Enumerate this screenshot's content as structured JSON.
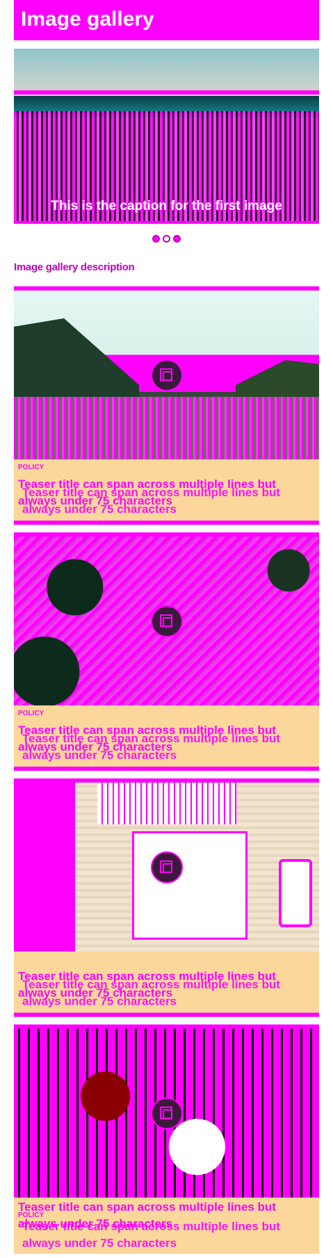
{
  "header": {
    "title": "Image gallery"
  },
  "hero": {
    "caption": "This is the caption for the first image"
  },
  "carousel": {
    "dots": [
      {
        "icon": "dot",
        "active": false
      },
      {
        "icon": "dot",
        "active": true
      },
      {
        "icon": "dot",
        "active": false
      }
    ]
  },
  "gallery": {
    "description": "Image gallery description"
  },
  "cards": [
    {
      "label": "POLICY",
      "title": "Teaser title can span across multiple lines but always under 75 characters",
      "title_echo": "Teaser title can span across multiple lines but always under 75 characters"
    },
    {
      "label": "POLICY",
      "title": "Teaser title can span across multiple lines but always under 75 characters",
      "title_echo": "Teaser title can span across multiple lines but always under 75 characters"
    },
    {
      "label": "",
      "title": "Teaser title can span across multiple lines but always under 75 characters",
      "title_echo": "Teaser title can span across multiple lines but always under 75 characters"
    },
    {
      "label": "POLICY",
      "title": "Teaser title can span across multiple lines but always under 75 characters",
      "title_echo": "Teaser title can span across multiple lines but always under 75 characters"
    }
  ],
  "icons": {
    "play": "play-icon"
  },
  "colors": {
    "accent": "#ff00ff",
    "card_bg": "#fcd79b",
    "text": "#c000c0"
  }
}
